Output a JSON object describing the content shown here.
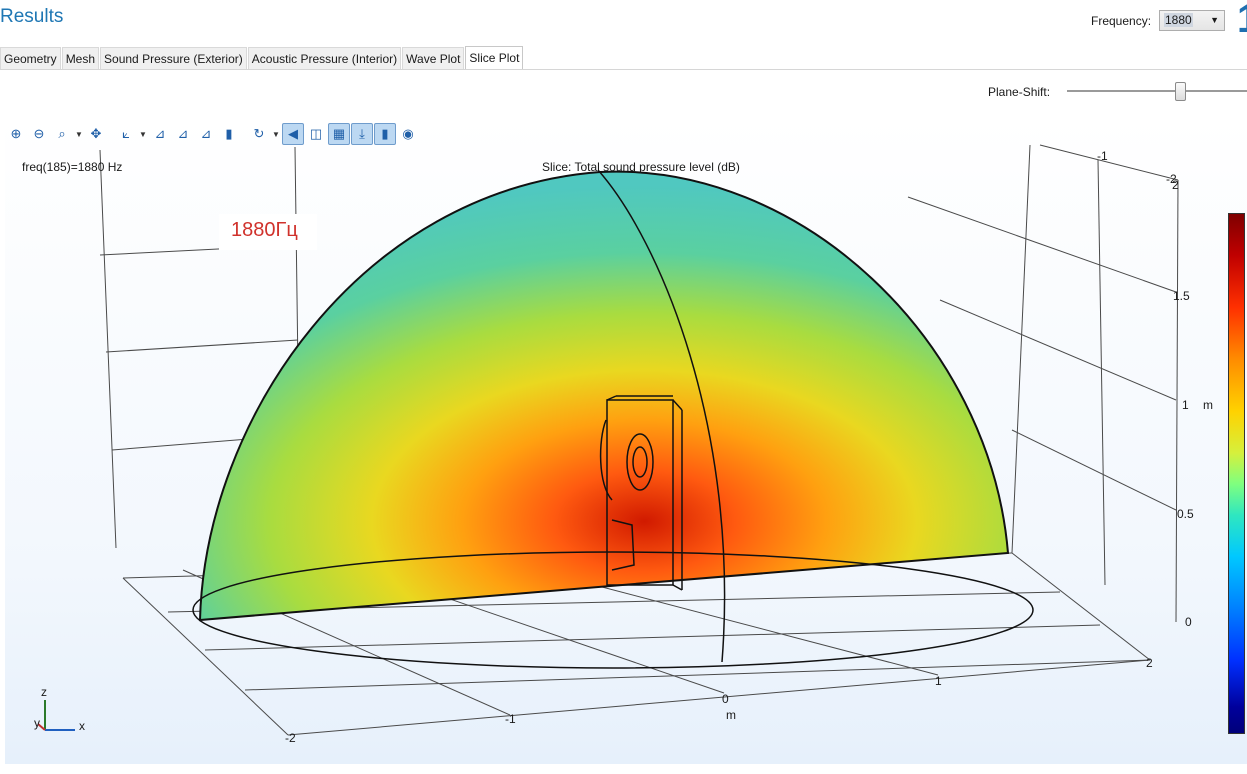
{
  "header": {
    "title": "Results",
    "frequency_label": "Frequency:",
    "frequency_value": "1880"
  },
  "tabs": [
    {
      "label": "Geometry"
    },
    {
      "label": "Mesh"
    },
    {
      "label": "Sound Pressure (Exterior)"
    },
    {
      "label": "Acoustic Pressure (Interior)"
    },
    {
      "label": "Wave Plot"
    },
    {
      "label": "Slice Plot",
      "active": true
    }
  ],
  "plane_shift": {
    "label": "Plane-Shift:",
    "position_fraction": 0.62
  },
  "toolbar": {
    "icons": [
      "zoom-in-icon",
      "zoom-out-icon",
      "zoom-box-icon",
      "zoom-dropdown-icon",
      "zoom-extents-icon",
      "view-axes-icon",
      "view-dropdown-icon",
      "view-xy-icon",
      "view-yz-icon",
      "view-xz-icon",
      "go-to-view-icon",
      "reset-rotation-icon",
      "reset-dropdown-icon",
      "speaker-icon",
      "transparency-icon",
      "grid-icon",
      "axis-orientation-icon",
      "color-legend-icon",
      "camera-icon"
    ]
  },
  "plot": {
    "freq_text": "freq(185)=1880 Hz",
    "title": "Slice: Total sound pressure level (dB)",
    "annotation": "1880Гц",
    "z_ticks": [
      "2",
      "1.5",
      "1",
      "0.5",
      "0"
    ],
    "z_unit": "m",
    "y_tick": "-1",
    "y_top_tick": "-2",
    "x_ticks": [
      "-2",
      "-1",
      "0",
      "1",
      "2"
    ],
    "x_unit": "m",
    "triad": {
      "z": "z",
      "y": "y",
      "x": "x"
    },
    "colors": {
      "accent": "#1f77b4",
      "annotation": "#d0322c"
    }
  }
}
